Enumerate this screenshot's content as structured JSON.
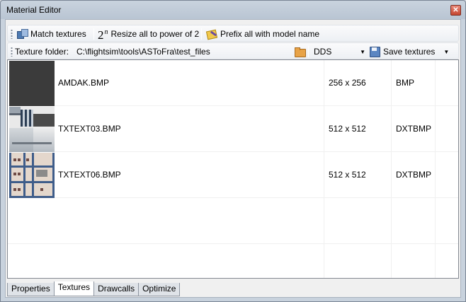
{
  "window": {
    "title": "Material Editor",
    "close_glyph": "✕"
  },
  "toolbar": {
    "match_label": "Match textures",
    "resize_base": "2",
    "resize_exp": "n",
    "resize_label": "Resize all to power of 2",
    "prefix_label": "Prefix all with model name"
  },
  "folder_bar": {
    "label": "Texture folder:",
    "path": "C:\\flightsim\\tools\\ASToFra\\test_files",
    "format_selected": "DDS",
    "save_label": "Save textures",
    "arrow": "▼"
  },
  "textures": {
    "rows": [
      {
        "name": "AMDAK.BMP",
        "size": "256 x 256",
        "format": "BMP"
      },
      {
        "name": "TXTEXT03.BMP",
        "size": "512 x 512",
        "format": "DXTBMP"
      },
      {
        "name": "TXTEXT06.BMP",
        "size": "512 x 512",
        "format": "DXTBMP"
      }
    ]
  },
  "tabs": [
    "Properties",
    "Textures",
    "Drawcalls",
    "Optimize"
  ],
  "active_tab": "Textures",
  "colors": {
    "title_bar": "#b9c5d3",
    "close_button": "#c54630",
    "tab_frame": "#8e96a1"
  }
}
